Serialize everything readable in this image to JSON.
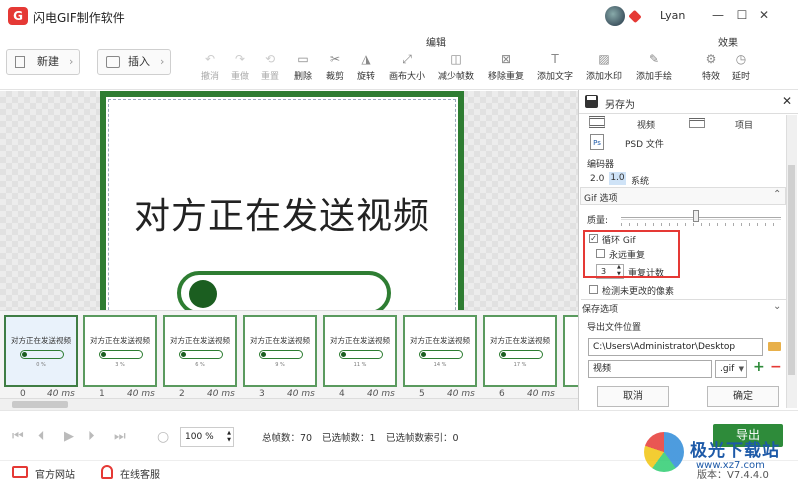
{
  "app": {
    "title": "闪电GIF制作软件",
    "user": "Lyan",
    "logo_glyph": "G"
  },
  "window": {
    "min": "—",
    "max": "☐",
    "close": "✕"
  },
  "toolbar": {
    "new_label": "新建",
    "insert_label": "插入",
    "group_edit": "编辑",
    "group_effect": "效果",
    "tools": [
      {
        "label": "撤消",
        "disabled": true
      },
      {
        "label": "重做",
        "disabled": true
      },
      {
        "label": "重置",
        "disabled": true
      },
      {
        "label": "删除",
        "disabled": false
      },
      {
        "label": "裁剪",
        "disabled": false
      },
      {
        "label": "旋转",
        "disabled": false
      },
      {
        "label": "画布大小",
        "disabled": false
      },
      {
        "label": "减少帧数",
        "disabled": false
      },
      {
        "label": "移除重复",
        "disabled": false
      },
      {
        "label": "添加文字",
        "disabled": false
      },
      {
        "label": "添加水印",
        "disabled": false
      },
      {
        "label": "添加手绘",
        "disabled": false
      },
      {
        "label": "特效",
        "disabled": false
      },
      {
        "label": "延时",
        "disabled": false
      }
    ]
  },
  "preview": {
    "text": "对方正在发送视频"
  },
  "frames": [
    {
      "index": "0",
      "delay": "40 ms",
      "text": "对方正在发送视频",
      "pct": "0 %"
    },
    {
      "index": "1",
      "delay": "40 ms",
      "text": "对方正在发送视频",
      "pct": "3 %"
    },
    {
      "index": "2",
      "delay": "40 ms",
      "text": "对方正在发送视频",
      "pct": "6 %"
    },
    {
      "index": "3",
      "delay": "40 ms",
      "text": "对方正在发送视频",
      "pct": "9 %"
    },
    {
      "index": "4",
      "delay": "40 ms",
      "text": "对方正在发送视频",
      "pct": "11 %"
    },
    {
      "index": "5",
      "delay": "40 ms",
      "text": "对方正在发送视频",
      "pct": "14 %"
    },
    {
      "index": "6",
      "delay": "40 ms",
      "text": "对方正在发送视频",
      "pct": "17 %"
    }
  ],
  "panel": {
    "title": "另存为",
    "close": "✕",
    "type_video": "视频",
    "type_project": "项目",
    "type_psd": "PSD 文件",
    "encoder_label": "编码器",
    "enc_20": "2.0",
    "enc_10": "1.0",
    "enc_system": "系统",
    "gif_options": "Gif 选项",
    "quality_label": "质量:",
    "quality_value": 0.47,
    "loop_gif": "循环 Gif",
    "forever": "永远重复",
    "repeat_count_value": "3",
    "repeat_count_label": "重复计数",
    "detect_unchanged": "检测未更改的像素",
    "save_options": "保存选项",
    "export_location": "导出文件位置",
    "path": "C:\\Users\\Administrator\\Desktop",
    "filename": "视频",
    "ext": ".gif",
    "cancel": "取消",
    "ok": "确定"
  },
  "bottom": {
    "zoom_value": "100",
    "zoom_unit": "%",
    "total_frames": "总帧数：70",
    "selected_frames": "已选帧数：1",
    "selected_index": "已选帧数索引：0",
    "export": "导出"
  },
  "footer": {
    "site": "官方网站",
    "service": "在线客服",
    "version": "版本：V7.4.4.0"
  },
  "watermark": {
    "title": "极光下载站",
    "url": "www.xz7.com"
  },
  "colors": {
    "accent": "#2e8b3a",
    "brand_red": "#e53935",
    "frame_green": "#2e7d32"
  }
}
